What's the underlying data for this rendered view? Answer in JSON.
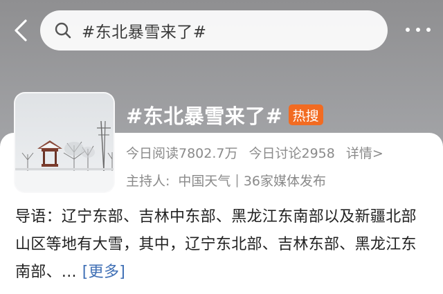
{
  "search": {
    "query": "#东北暴雪来了#"
  },
  "topic": {
    "title": "#东北暴雪来了#",
    "badge": "热搜",
    "reads": "今日阅读7802.7万",
    "discussions": "今日讨论2958",
    "details_link": "详情>",
    "host_label": "主持人:",
    "host_name": "中国天气",
    "media_count": "36家媒体发布"
  },
  "intro": {
    "text": "导语：辽宁东部、吉林中东部、黑龙江东南部以及新疆北部山区等地有大雪，其中，辽宁东北部、吉林东部、黑龙江东南部、...",
    "more_label": "[更多]"
  },
  "colors": {
    "badge": "#f26b21",
    "link": "#3f6fb5",
    "header_bg": "#9a9b9e"
  },
  "icons": [
    "back-arrow-icon",
    "search-icon",
    "more-dots-icon"
  ]
}
